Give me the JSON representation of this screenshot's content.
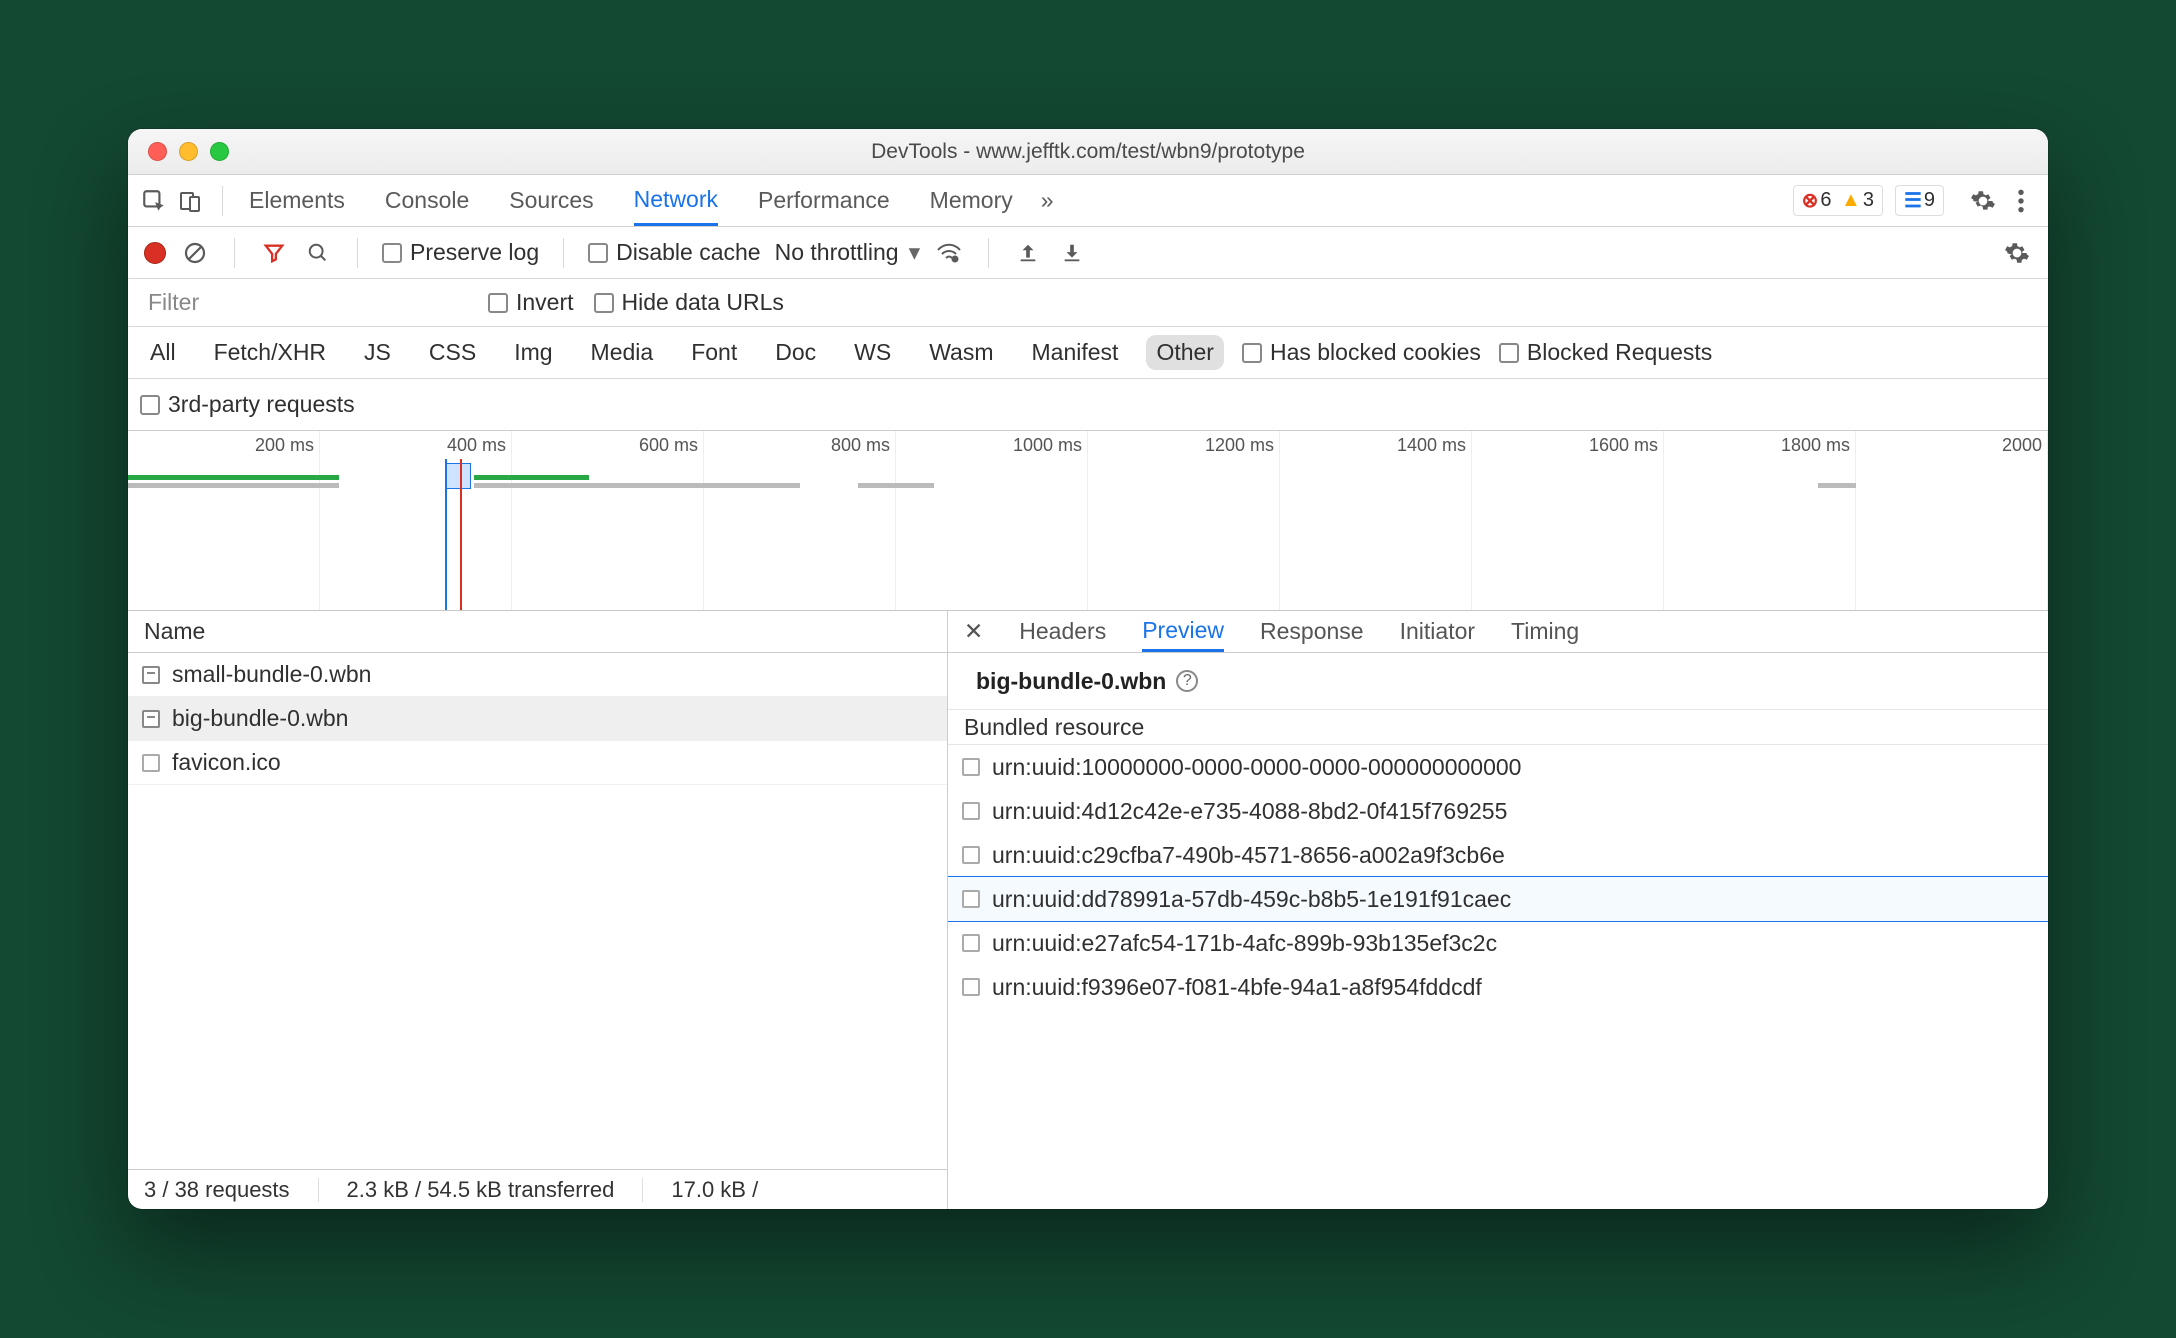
{
  "window": {
    "title": "DevTools - www.jefftk.com/test/wbn9/prototype"
  },
  "main_tabs": {
    "items": [
      "Elements",
      "Console",
      "Sources",
      "Network",
      "Performance",
      "Memory"
    ],
    "active": "Network",
    "more": "»"
  },
  "counters": {
    "errors": "6",
    "warnings": "3",
    "messages": "9"
  },
  "toolbar": {
    "preserve_log": "Preserve log",
    "disable_cache": "Disable cache",
    "throttling": "No throttling"
  },
  "filter": {
    "placeholder": "Filter",
    "invert": "Invert",
    "hide_data_urls": "Hide data URLs"
  },
  "types": {
    "items": [
      "All",
      "Fetch/XHR",
      "JS",
      "CSS",
      "Img",
      "Media",
      "Font",
      "Doc",
      "WS",
      "Wasm",
      "Manifest",
      "Other"
    ],
    "active": "Other",
    "has_blocked_cookies": "Has blocked cookies",
    "blocked_requests": "Blocked Requests",
    "third_party": "3rd-party requests"
  },
  "timeline": {
    "ticks": [
      "200 ms",
      "400 ms",
      "600 ms",
      "800 ms",
      "1000 ms",
      "1200 ms",
      "1400 ms",
      "1600 ms",
      "1800 ms",
      "2000"
    ]
  },
  "requests": {
    "column": "Name",
    "rows": [
      {
        "name": "small-bundle-0.wbn",
        "icon": "doc",
        "selected": false
      },
      {
        "name": "big-bundle-0.wbn",
        "icon": "doc",
        "selected": true
      },
      {
        "name": "favicon.ico",
        "icon": "generic",
        "selected": false
      }
    ]
  },
  "status": {
    "requests": "3 / 38 requests",
    "transferred": "2.3 kB / 54.5 kB transferred",
    "resources": "17.0 kB /"
  },
  "detail": {
    "tabs": [
      "Headers",
      "Preview",
      "Response",
      "Initiator",
      "Timing"
    ],
    "active": "Preview",
    "title": "big-bundle-0.wbn",
    "section": "Bundled resource",
    "resources": [
      "urn:uuid:10000000-0000-0000-0000-000000000000",
      "urn:uuid:4d12c42e-e735-4088-8bd2-0f415f769255",
      "urn:uuid:c29cfba7-490b-4571-8656-a002a9f3cb6e",
      "urn:uuid:dd78991a-57db-459c-b8b5-1e191f91caec",
      "urn:uuid:e27afc54-171b-4afc-899b-93b135ef3c2c",
      "urn:uuid:f9396e07-f081-4bfe-94a1-a8f954fddcdf"
    ],
    "highlighted_index": 3
  }
}
